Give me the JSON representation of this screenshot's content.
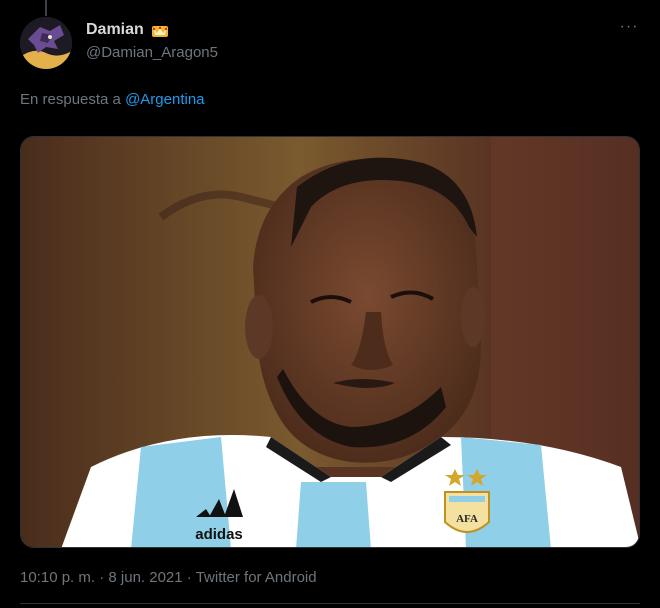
{
  "tweet": {
    "display_name": "Damian",
    "badge_icon": "crown-icon",
    "handle": "@Damian_Aragon5",
    "more_icon": "more-dots-icon",
    "more_label": "···",
    "reply_prefix": "En respuesta a",
    "reply_mention": "@Argentina",
    "media_icon": "photo",
    "jersey_brand": "adidas",
    "crest_text": "AFA",
    "time": "10:10 p. m.",
    "separator": "·",
    "date": "8 jun. 2021",
    "source": "Twitter for Android"
  },
  "colors": {
    "background": "#000000",
    "text": "#d9d9d9",
    "muted": "#6e767d",
    "link": "#1d9bf0",
    "crown": "#f2b632"
  }
}
